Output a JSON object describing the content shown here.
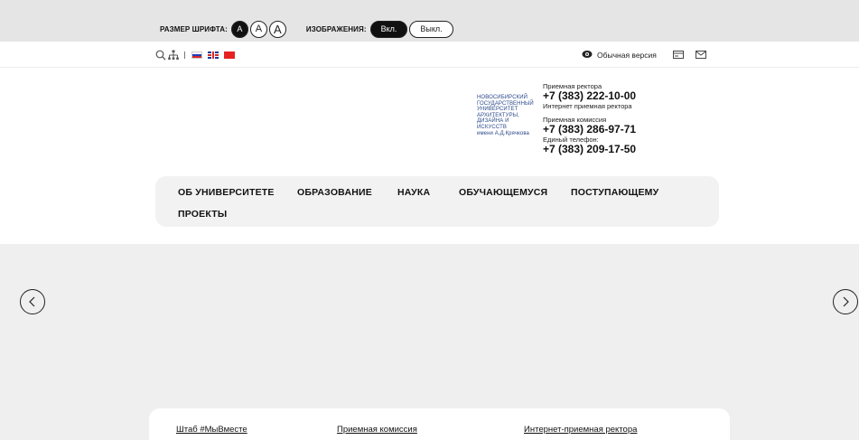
{
  "accessibility": {
    "font_size_label": "РАЗМЕР ШРИФТА:",
    "font_buttons": [
      "A",
      "A",
      "A"
    ],
    "images_label": "ИЗОБРАЖЕНИЯ:",
    "images_on": "Вкл.",
    "images_off": "Выкл."
  },
  "utility": {
    "icons": [
      "search-icon",
      "sitemap-icon"
    ],
    "languages": [
      "ru-flag",
      "gb-flag",
      "cn-flag"
    ],
    "version_label": "Обычная версия",
    "right_icons": [
      "eye-icon",
      "card-icon",
      "mail-icon"
    ]
  },
  "logo": {
    "lines": [
      "НОВОСИБИРСКИЙ",
      "ГОСУДАРСТВЕННЫЙ",
      "УНИВЕРСИТЕТ",
      "АРХИТЕКТУРЫ,",
      "ДИЗАЙНА И",
      "ИСКУССТВ",
      "имени А.Д.Крячкова"
    ]
  },
  "contacts": {
    "rector_label": "Приемная ректора",
    "rector_phone": "+7 (383) 222-10-00",
    "rector_online": "Интернет приемная ректора",
    "admission_label": "Приемная комиссия",
    "admission_phone": "+7 (383) 286-97-71",
    "unified_label": "Единый телефон:",
    "unified_phone": "+7 (383) 209-17-50"
  },
  "nav": {
    "items": [
      "ОБ УНИВЕРСИТЕТЕ",
      "ОБРАЗОВАНИЕ",
      "НАУКА",
      "ОБУЧАЮЩЕМУСЯ",
      "ПОСТУПАЮЩЕМУ",
      "ПРОЕКТЫ"
    ]
  },
  "quick_links": [
    "Штаб #МыВместе",
    "Приемная комиссия",
    "Интернет-приемная ректора"
  ]
}
